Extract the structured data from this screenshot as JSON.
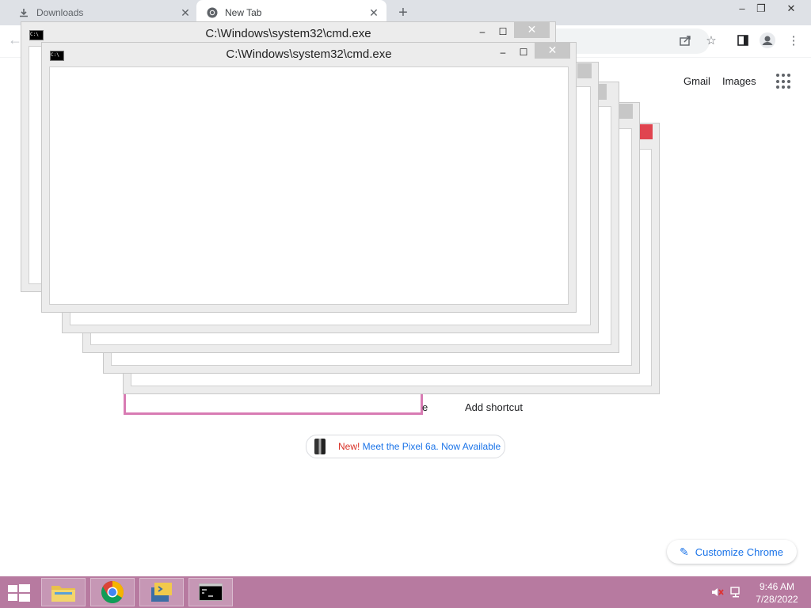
{
  "browser": {
    "tabs": [
      {
        "label": "Downloads",
        "icon": "download-icon"
      },
      {
        "label": "New Tab",
        "icon": "chrome-icon"
      }
    ],
    "new_tab_symbol": "+",
    "window_controls": {
      "minimize": "–",
      "restore": "❐",
      "close": "✕"
    },
    "tab_close": "✕"
  },
  "ntp": {
    "gmail": "Gmail",
    "images": "Images",
    "shortcut_partial": "e",
    "add_shortcut": "Add shortcut",
    "promo_new": "New!",
    "promo_text": " Meet the Pixel 6a. Now Available",
    "customize": "Customize Chrome"
  },
  "cmd": {
    "title": "C:\\Windows\\system32\\cmd.exe",
    "icon_text": "C:\\",
    "min": "–",
    "max": "☐",
    "close": "✕"
  },
  "taskbar": {
    "time": "9:46 AM",
    "date": "7/28/2022",
    "apps": [
      "file-explorer-icon",
      "chrome-icon",
      "python-icon",
      "cmd-icon"
    ]
  }
}
